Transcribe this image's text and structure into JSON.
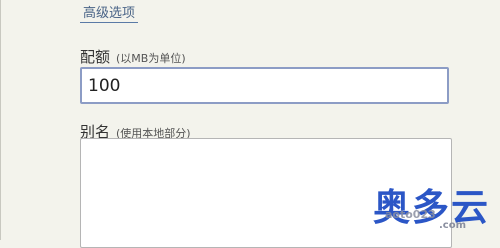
{
  "advanced_options": {
    "label": "高级选项"
  },
  "quota": {
    "label": "配额",
    "hint": "(以MB为单位)",
    "value": "100"
  },
  "alias": {
    "label": "别名",
    "hint": "(使用本地部分)",
    "value": ""
  },
  "watermark": {
    "text": "奥多云",
    "small": "aoto023",
    "domain": ".com",
    "color": "#2b56c6"
  },
  "colors": {
    "background": "#f3f3ec",
    "link": "#4a6487",
    "input_focus_border": "#8c9cc5"
  }
}
